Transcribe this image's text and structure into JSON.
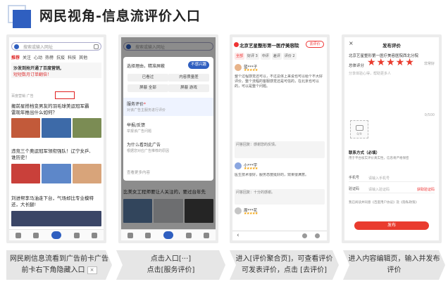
{
  "header": {
    "title": "网民视角-信息流评价入口"
  },
  "phone1": {
    "search_placeholder": "搜索或输入网址",
    "tabs": [
      "推荐",
      "关注",
      "心动",
      "热榜",
      "抗疫",
      "科技",
      "其他"
    ],
    "card_title": "沙发到抢开通了百度营销,",
    "card_subtitle": "短短数月订单翻倍！",
    "card_meta": "百度营销 广告",
    "news": [
      {
        "title": "搬前星搭档变男友的羽毛球美运冠军霸",
        "title2": "雷现年推出什么如何？"
      },
      {
        "title": "违竞三个奥运冠军领衔强队！辽宁女乒,",
        "title2": "谁历史！"
      },
      {
        "title": "刘进帮李马油走下台，气场却比专业模特",
        "title2": "还，大长腿!"
      }
    ]
  },
  "phone2": {
    "search_placeholder": "搜索或输入网址",
    "reason_title": "选择理由，精准屏蔽",
    "reason_badge": "不感兴趣",
    "options": [
      "已看过",
      "内容质量差",
      "屏蔽 全部",
      "屏蔽 游戏"
    ],
    "service_eval": "服务评价",
    "service_eval_sub": "对该广告主服务进行评价",
    "report": "举报/反馈",
    "report_sub": "举报该广告问题",
    "why": "为什么看到此广告",
    "why_sub": "根据您对应广告推荐的原因",
    "footer": "查看更多内容",
    "news": "比美女工程师要让人关注的，要过台年先"
  },
  "phone3": {
    "store": "北京艺星整形第一医疗美容院",
    "pill": "去评价",
    "tags": [
      "全部",
      "好评 3",
      "中评",
      "差评",
      "评价 2"
    ],
    "users": [
      {
        "name": "蓝***子",
        "stars": "★★★★★",
        "text": "整个过程感觉还可以，不过总体上来说也可以给个不大好评价。整个流程的客服感觉还是可信的，在北京也可以的，可以是整个问题。"
      },
      {
        "name": "小***宇",
        "stars": "★★★★★",
        "text": "医生技术很好，服务态度挺好的，效果很满意。"
      },
      {
        "name": "周***花",
        "stars": "★★★★★",
        "text": ""
      }
    ],
    "reply1": "问答回复：感谢您的反馈。",
    "reply2": "问答回复：十分的感谢。"
  },
  "phone4": {
    "title": "发布评价",
    "org": "北京艺星整形第一医疗美容医院西北分院",
    "score_label": "总体评分",
    "score_text": "非常好",
    "stars": "★★★★★",
    "textarea": "分享体验心得，帮助更多人",
    "count": "0/500",
    "photo_count": "0/9",
    "contact_title": "联系方式（必填）",
    "contact_desc": "用于平台核实评价真实性，信息将严格保密",
    "phone_label": "手机号",
    "phone_placeholder": "请输入手机号",
    "code_label": "验证码",
    "code_placeholder": "请输入验证码",
    "code_get": "获取验证码",
    "agree": "我已阅读并同意《百度用户协议》及《隐私政策》",
    "submit": "发布"
  },
  "captions": [
    {
      "line1": "网民刷信息流看到广告前卡广告",
      "line2": "前卡右下角隐藏入口"
    },
    {
      "line1": "点击入口[···]",
      "line2": "点击[服务评价]"
    },
    {
      "line1": "进入[评价聚合页]，可查看评价",
      "line2": "可发表评价，点击 [去评价]"
    },
    {
      "line1": "进入内容编辑页，输入并发布",
      "line2": "评价"
    }
  ],
  "caption_chip": "×",
  "colors": {
    "accent_blue": "#2f5fc0",
    "accent_red": "#e93b2e"
  }
}
